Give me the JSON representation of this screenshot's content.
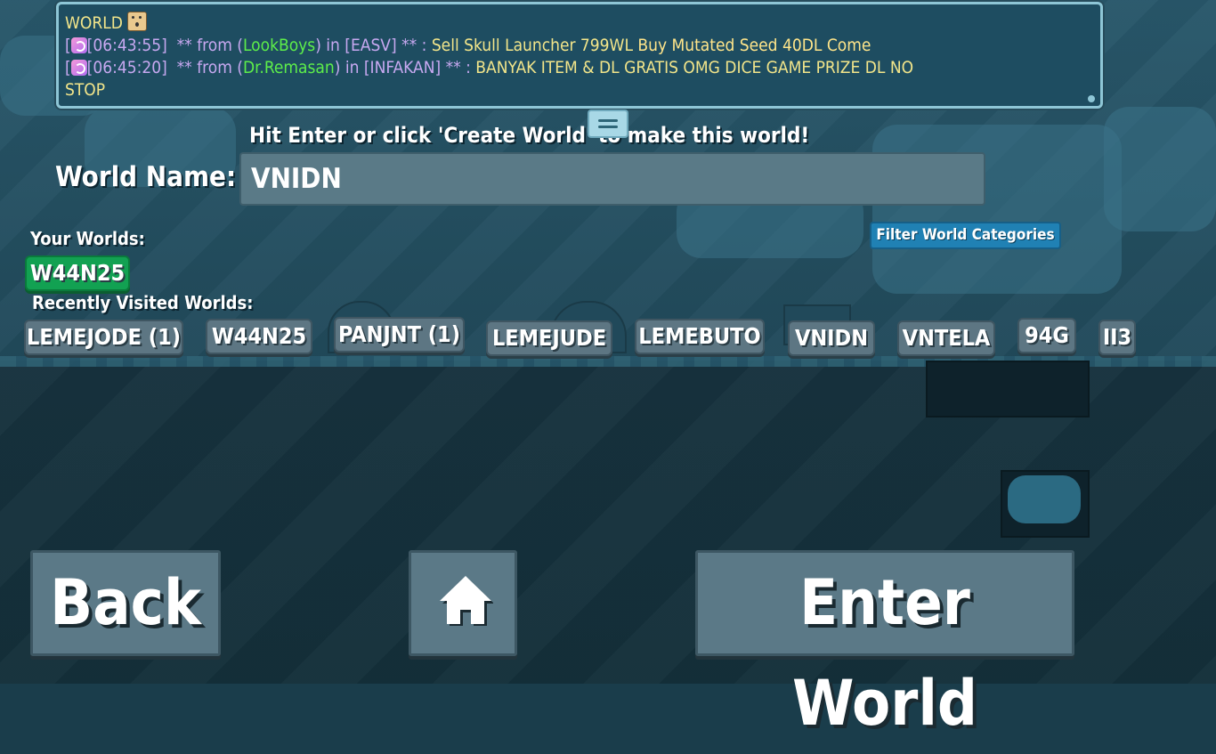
{
  "chat": {
    "first_line": "WORLD",
    "messages": [
      {
        "time": "[06:43:55]",
        "from_label": "** from (",
        "name": "LookBoys",
        "in_label": ") in [",
        "world": "EASV",
        "stars": "] ** :",
        "text": "Sell Skull Launcher 799WL",
        "text2": "Buy Mutated Seed 40DL Come"
      },
      {
        "time": "[06:45:20]",
        "from_label": "** from (",
        "name": "Dr.Remasan",
        "in_label": ") in [",
        "world": "INFAKAN",
        "stars": "] ** :",
        "text": "BANYAK ITEM & DL GRATIS OMG DICE GAME PRIZE DL NO",
        "text_cont": "STOP"
      }
    ]
  },
  "hint": "Hit Enter or click 'Create World' to make this world!",
  "world_name": {
    "label": "World Name:",
    "value": "VNIDN"
  },
  "your_worlds": {
    "label": "Your Worlds:",
    "items": [
      "W44N25"
    ]
  },
  "filter_button": "Filter World Categories",
  "recent_worlds": {
    "label": "Recently Visited Worlds:",
    "items": [
      "LEMEJODE (1)",
      "W44N25",
      "PANJNT (1)",
      "LEMEJUDE",
      "LEMEBUTO",
      "VNIDN",
      "VNTELA",
      "94G",
      "II3"
    ]
  },
  "buttons": {
    "back": "Back",
    "home_icon": "home-icon",
    "enter": "Enter World"
  }
}
